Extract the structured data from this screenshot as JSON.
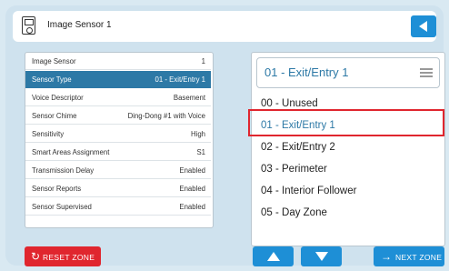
{
  "header": {
    "title": "Image Sensor 1"
  },
  "settings": [
    {
      "label": "Image Sensor",
      "value": "1"
    },
    {
      "label": "Sensor Type",
      "value": "01 - Exit/Entry 1"
    },
    {
      "label": "Voice Descriptor",
      "value": "Basement"
    },
    {
      "label": "Sensor Chime",
      "value": "Ding-Dong #1 with Voice"
    },
    {
      "label": "Sensitivity",
      "value": "High"
    },
    {
      "label": "Smart Areas Assignment",
      "value": "S1"
    },
    {
      "label": "Transmission Delay",
      "value": "Enabled"
    },
    {
      "label": "Sensor Reports",
      "value": "Enabled"
    },
    {
      "label": "Sensor Supervised",
      "value": "Enabled"
    }
  ],
  "selected_setting": "Sensor Type",
  "selector": {
    "current": "01 - Exit/Entry 1",
    "options": [
      "00 - Unused",
      "01 - Exit/Entry 1",
      "02 - Exit/Entry 2",
      "03 - Perimeter",
      "04 - Interior Follower",
      "05 - Day Zone"
    ],
    "selected_option": "01 - Exit/Entry 1"
  },
  "buttons": {
    "reset_label": "RESET ZONE",
    "next_label": "NEXT ZONE"
  },
  "icons": {
    "device": "image-sensor-icon",
    "back": "back-arrow-icon",
    "reset": "refresh-icon",
    "next": "right-arrow-icon",
    "up": "up-arrow-icon",
    "down": "down-arrow-icon",
    "menu": "hamburger-icon"
  },
  "colors": {
    "accent": "#1e8fd6",
    "selected_row": "#2d79a6",
    "danger": "#e0262e"
  }
}
